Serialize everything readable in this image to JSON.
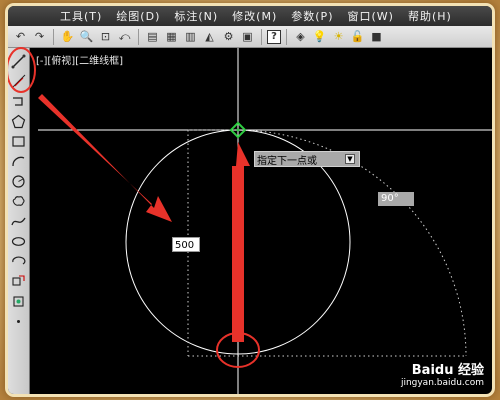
{
  "menu": [
    "工具(T)",
    "绘图(D)",
    "标注(N)",
    "修改(M)",
    "参数(P)",
    "窗口(W)",
    "帮助(H)"
  ],
  "toolbar": {
    "icons": [
      "undo-icon",
      "redo-icon",
      "pan-icon",
      "zoom-realtime-icon",
      "zoom-window-icon",
      "zoom-previous-icon",
      "properties-icon",
      "design-center-icon",
      "tool-palettes-icon",
      "sheet-set-icon",
      "markup-icon",
      "calculator-icon",
      "help-icon",
      "layer-icon",
      "bulb-icon",
      "sun-icon",
      "lock-icon",
      "color-icon"
    ],
    "help_label": "?"
  },
  "viewport_label": "[-][俯视][二维线框]",
  "tooltip": {
    "text": "指定下一点或",
    "arrow": "▼"
  },
  "angle_label": "90°",
  "length_input": "500",
  "watermark": {
    "line1": "Baidu 经验",
    "line2": "jingyan.baidu.com"
  },
  "colors": {
    "annotation_red": "#e8322a",
    "drawing": "#ffffff",
    "grip": "#2ecc40",
    "background": "#000000"
  }
}
